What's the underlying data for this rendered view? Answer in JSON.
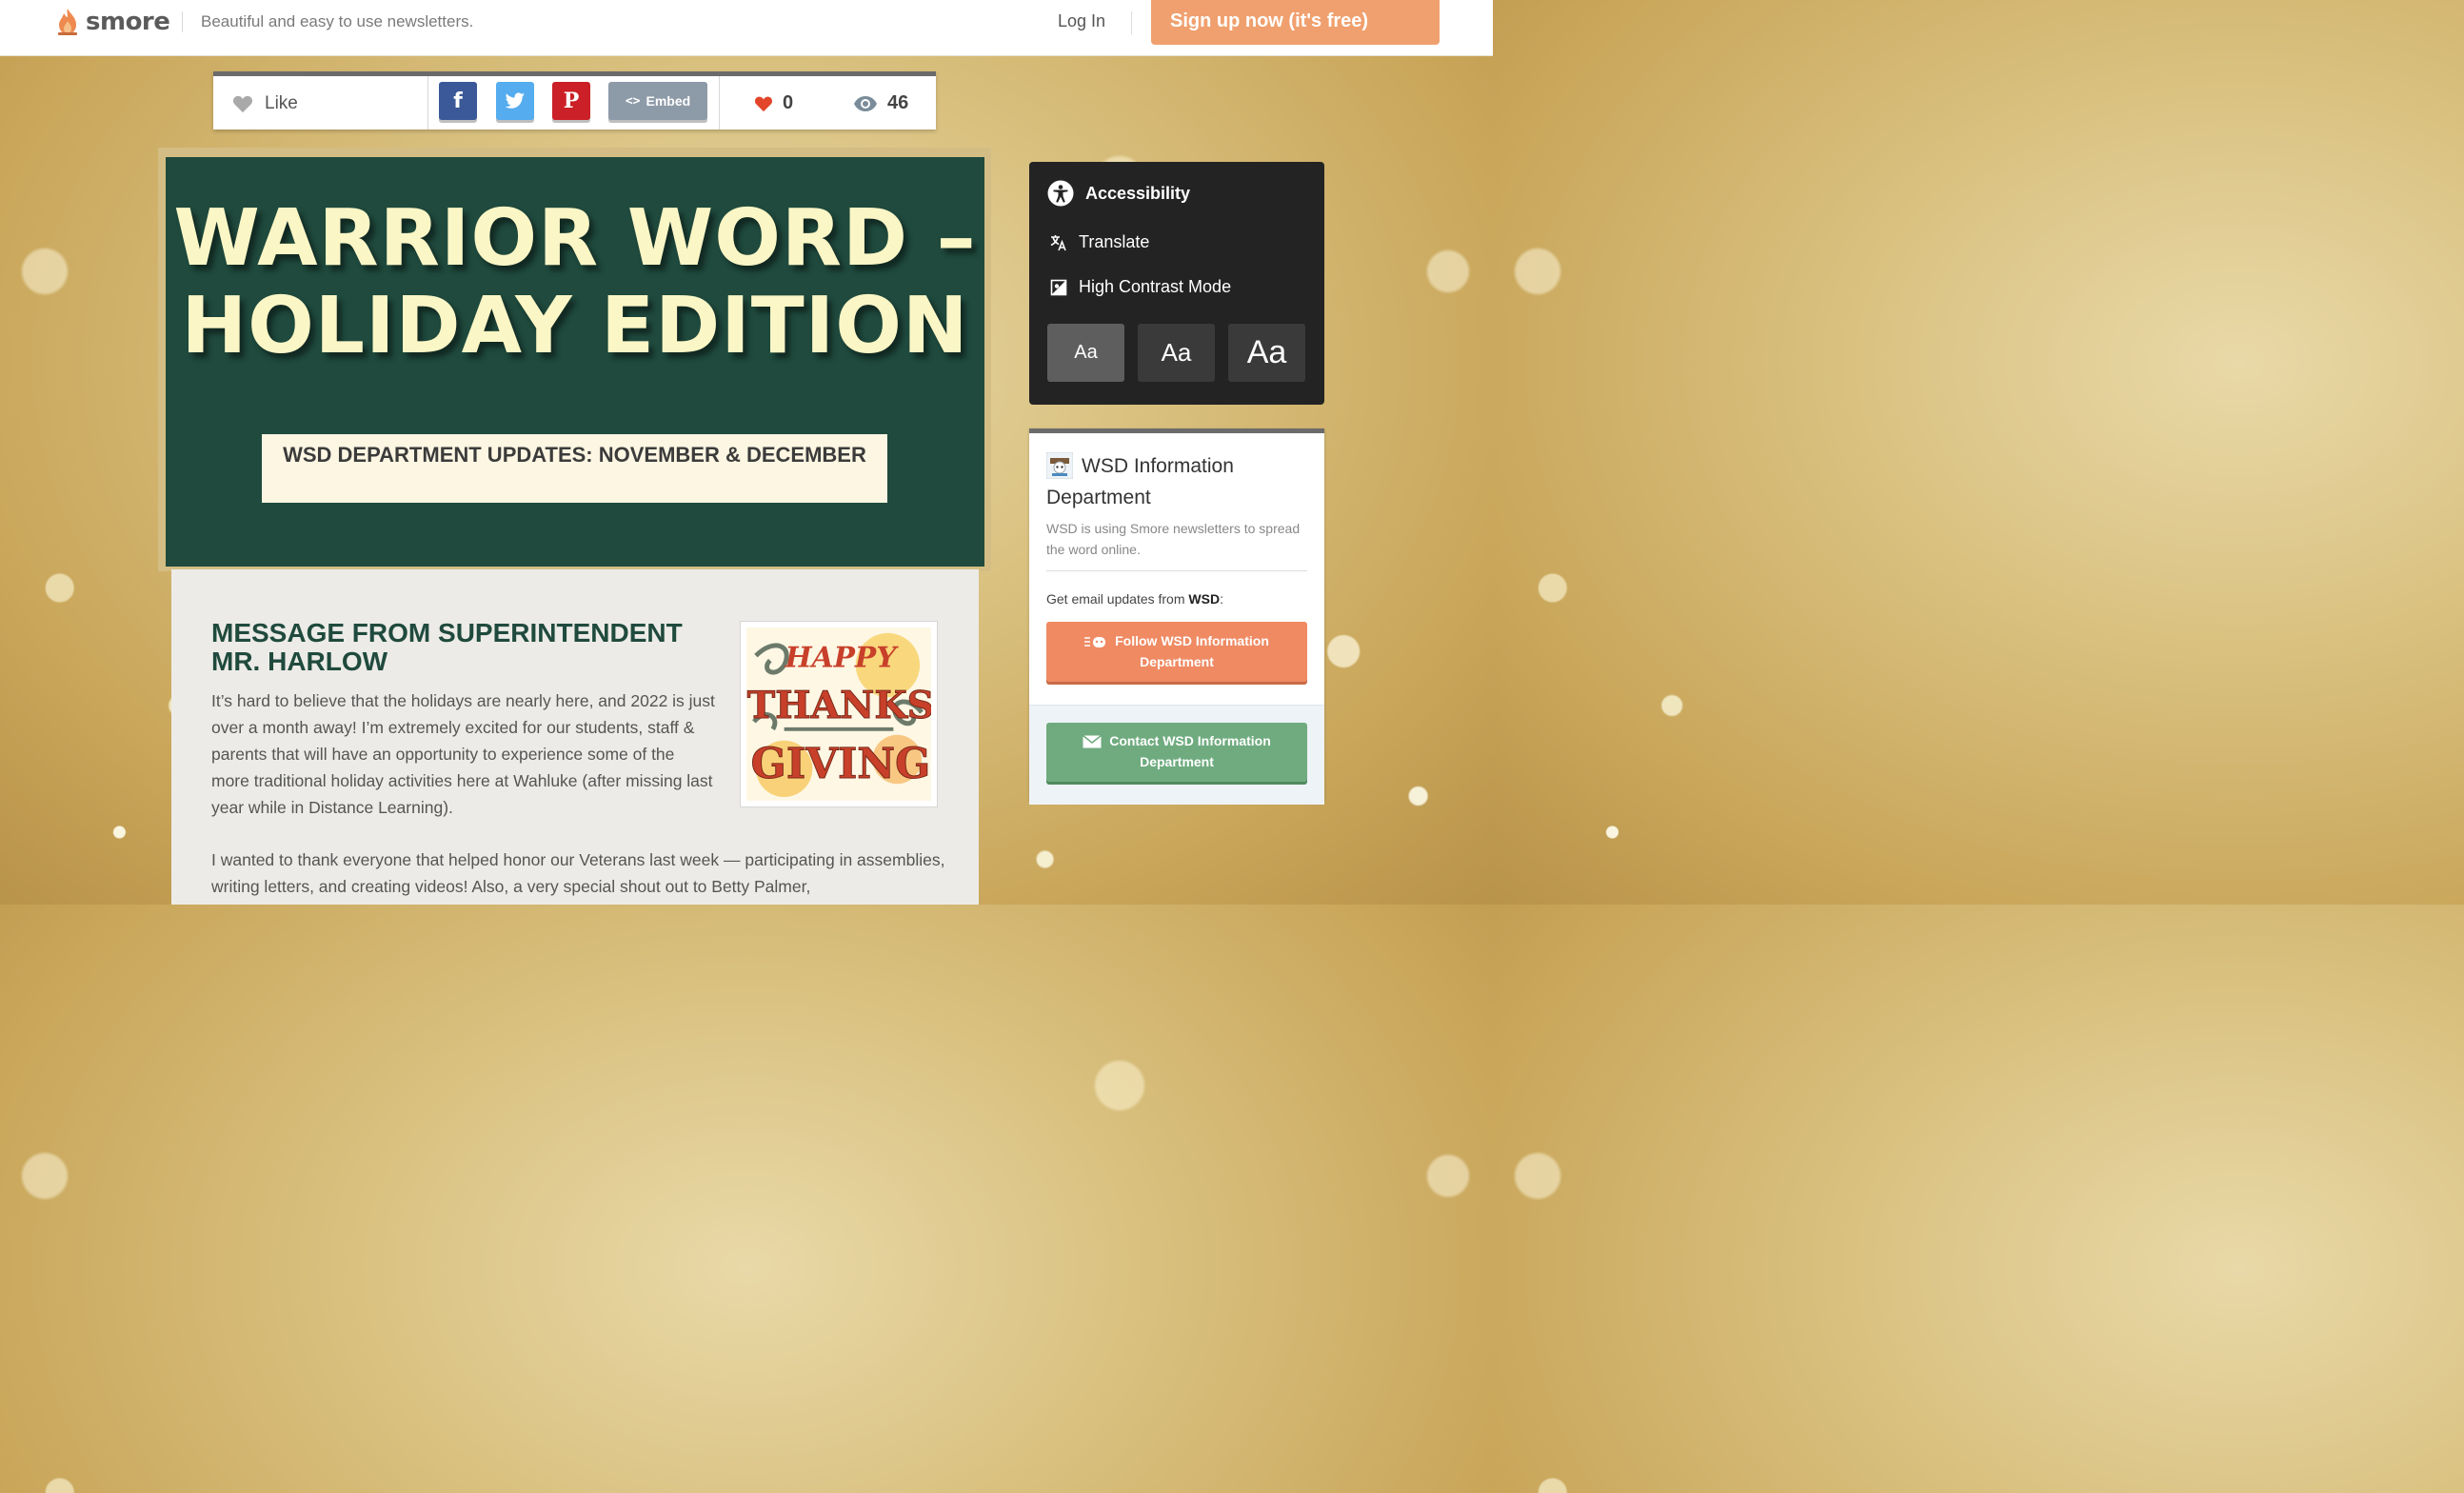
{
  "topbar": {
    "brand": "smore",
    "tagline": "Beautiful and easy to use newsletters.",
    "login": "Log In",
    "signup": "Sign up now (it's free)"
  },
  "social": {
    "like_label": "Like",
    "facebook": "f",
    "pinterest": "P",
    "embed_label": "Embed",
    "hearts": "0",
    "views": "46"
  },
  "hero": {
    "title_line1": "WARRIOR WORD –",
    "title_line2": "HOLIDAY EDITION",
    "subtitle": "WSD DEPARTMENT UPDATES: NOVEMBER & DECEMBER"
  },
  "content": {
    "heading": "MESSAGE FROM SUPERINTENDENT MR. HARLOW",
    "paragraph1": "It’s hard to believe that the holidays are nearly here, and 2022 is just over a month away! I’m extremely excited for our students, staff & parents that will have an opportunity to experience some of the more traditional holiday activities here at Wahluke (after missing last year while in Distance Learning).",
    "paragraph2": "I wanted to thank everyone that helped honor our Veterans last week — participating in assemblies, writing letters, and creating videos! Also, a very special shout out to Betty Palmer,",
    "image_text_1": "HAPPY",
    "image_text_2": "THANKS",
    "image_text_3": "GIVING"
  },
  "accessibility": {
    "title": "Accessibility",
    "translate": "Translate",
    "high_contrast": "High Contrast Mode",
    "font_small": "Aa",
    "font_medium": "Aa",
    "font_large": "Aa"
  },
  "info": {
    "org_name": "WSD Information Department",
    "description": "WSD is using Smore newsletters to spread the word online.",
    "email_prefix": "Get email updates from ",
    "email_org": "WSD",
    "email_suffix": ":",
    "follow_label": "Follow WSD Information Department",
    "contact_label": "Contact WSD Information Department"
  },
  "colors": {
    "hero_green": "#1f4a3d",
    "title_cream": "#fbf6c6",
    "signup_orange": "#f0a06e",
    "follow_orange": "#ef8a63",
    "contact_green": "#6fab7f"
  },
  "icons": [
    "smore-flame-icon",
    "heart-icon",
    "facebook-icon",
    "twitter-icon",
    "pinterest-icon",
    "code-icon",
    "eye-icon",
    "accessibility-icon",
    "translate-icon",
    "contrast-icon",
    "follow-icon",
    "envelope-icon"
  ]
}
